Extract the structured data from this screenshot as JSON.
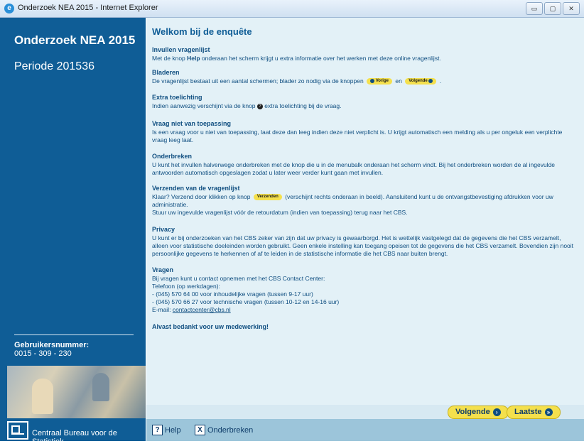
{
  "window": {
    "title": "Onderzoek NEA 2015 - Internet Explorer",
    "buttons": {
      "minimize": "▭",
      "maximize": "▢",
      "close": "✕"
    }
  },
  "sidebar": {
    "title": "Onderzoek NEA 2015",
    "period": "Periode 201536",
    "user_label": "Gebruikersnummer:",
    "user_value": "0015 - 309 - 230",
    "org": "Centraal Bureau voor de Statistiek"
  },
  "main": {
    "heading": "Welkom bij de enquête",
    "sections": [
      {
        "title": "Invullen vragenlijst",
        "text_pre": "Met de knop ",
        "text_bold": "Help",
        "text_post": " onderaan het scherm krijgt u extra informatie over het werken met deze online vragenlijst."
      },
      {
        "title": "Bladeren",
        "text_pre": "De vragenlijst bestaat uit een aantal schermen; blader zo nodig via de knoppen",
        "btn_prev": "Vorige",
        "text_mid": "en",
        "btn_next": "Volgende",
        "text_post": "."
      },
      {
        "title": "Extra toelichting",
        "text_pre": "Indien aanwezig verschijnt via de knop",
        "text_post": "extra toelichting bij de vraag."
      },
      {
        "title": "Vraag niet van toepassing",
        "text": "Is een vraag voor u niet van toepassing, laat deze dan leeg indien deze niet verplicht is. U krijgt automatisch een melding als u per ongeluk een verplichte vraag leeg laat."
      },
      {
        "title": "Onderbreken",
        "text": "U kunt het invullen halverwege onderbreken met de knop die u in de menubalk onderaan het scherm vindt. Bij het onderbreken worden de al ingevulde antwoorden automatisch opgeslagen zodat u later weer verder kunt gaan met invullen."
      },
      {
        "title": "Verzenden van de vragenlijst",
        "text_pre": "Klaar? Verzend door klikken op knop",
        "btn_send": "Verzenden",
        "text_post": "(verschijnt rechts onderaan in beeld). Aansluitend kunt u de ontvangstbevestiging afdrukken voor uw administratie.",
        "text2": "Stuur uw ingevulde vragenlijst vóór de retourdatum (indien van toepassing) terug naar het CBS."
      },
      {
        "title": "Privacy",
        "text": "U kunt er bij onderzoeken van het CBS zeker van zijn dat uw privacy is gewaarborgd. Het is wettelijk vastgelegd dat de gegevens die het CBS verzamelt, alleen voor statistische doeleinden worden gebruikt. Geen enkele instelling kan toegang opeisen tot de gegevens die het CBS verzamelt. Bovendien zijn nooit persoonlijke gegevens te herkennen of af te leiden in de statistische informatie die het CBS naar buiten brengt."
      },
      {
        "title": "Vragen",
        "lines": [
          "Bij vragen kunt u contact opnemen met het CBS Contact Center:",
          "Telefoon (op werkdagen):",
          "- (045) 570 64 00 voor inhoudelijke vragen (tussen 9-17 uur)",
          "- (045) 570 66 27 voor technische vragen (tussen 10-12 en 14-16 uur)"
        ],
        "email_label": "E-mail: ",
        "email": "contactcenter@cbs.nl"
      }
    ],
    "thanks": "Alvast bedankt voor uw medewerking!"
  },
  "nav": {
    "next": "Volgende",
    "last": "Laatste"
  },
  "menubar": {
    "help": "Help",
    "help_icon": "?",
    "interrupt": "Onderbreken",
    "interrupt_icon": "X"
  }
}
